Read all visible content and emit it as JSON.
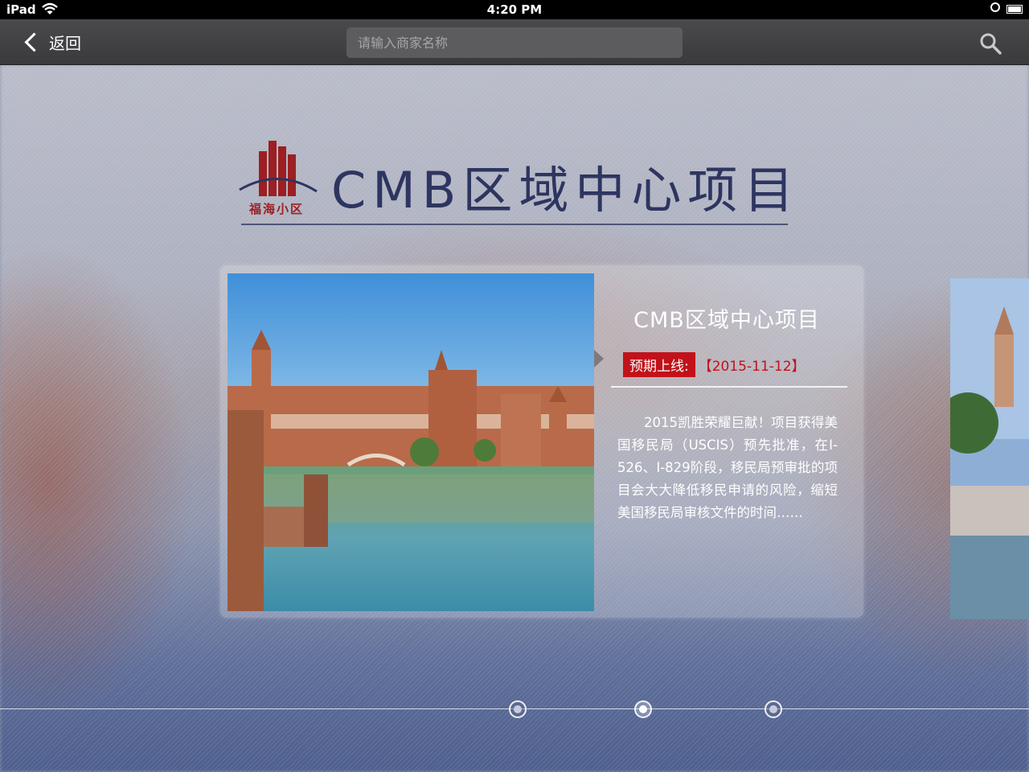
{
  "status_bar": {
    "device": "iPad",
    "time": "4:20 PM"
  },
  "nav": {
    "back_label": "返回",
    "search_placeholder": "请输入商家名称"
  },
  "header": {
    "logo_text": "福海小区",
    "title": "CMB区域中心项目"
  },
  "card": {
    "title": "CMB区域中心项目",
    "launch_label": "预期上线:",
    "launch_date": "【2015-11-12】",
    "description": "2015凯胜荣耀巨献！项目获得美国移民局（USCIS）预先批准，在I-526、I-829阶段，移民局预审批的项目会大大降低移民申请的风险，缩短美国移民局审核文件的时间……"
  },
  "pager": {
    "pages": 3,
    "active_index": 1
  },
  "colors": {
    "title_navy": "#2d3560",
    "badge_red": "#c1121a",
    "logo_red": "#9c1f22"
  }
}
